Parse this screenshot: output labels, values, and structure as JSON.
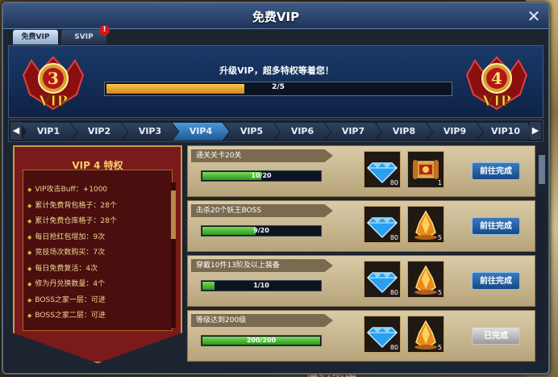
{
  "window": {
    "title": "免费VIP",
    "close": "✕"
  },
  "tabs": [
    {
      "label": "免费VIP",
      "active": true
    },
    {
      "label": "SVIP",
      "active": false,
      "badge": "!"
    }
  ],
  "header": {
    "current_vip": "3",
    "next_vip": "4",
    "vip_label": "VIP",
    "upgrade_text": "升级VIP，超多特权等着您！",
    "progress_text": "2/5",
    "progress_fraction": 0.4
  },
  "levels": {
    "items": [
      "VIP1",
      "VIP2",
      "VIP3",
      "VIP4",
      "VIP5",
      "VIP6",
      "VIP7",
      "VIP8",
      "VIP9",
      "VIP10"
    ],
    "active_index": 3,
    "prev_arrow": "◀",
    "next_arrow": "▶"
  },
  "privileges": {
    "title": "VIP 4 特权",
    "items": [
      "VIP攻击Buff：+1000",
      "累计免费背包格子：28个",
      "累计免费仓库格子：28个",
      "每日抢红包增加：9次",
      "竞技场次数购买：7次",
      "每日免费复活：4次",
      "修为丹兑换数量：4个",
      "BOSS之家一层：可进",
      "BOSS之家二层：可进"
    ]
  },
  "tasks": [
    {
      "label": "通关关卡20关",
      "progress": "10/20",
      "fraction": 0.5,
      "reward1_count": "80",
      "reward2_count": "1",
      "reward2_icon": "scroll-icon",
      "button": "前往完成",
      "done": false
    },
    {
      "label": "击杀20个妖王BOSS",
      "progress": "9/20",
      "fraction": 0.45,
      "reward1_count": "80",
      "reward2_count": "5",
      "reward2_icon": "crystal-icon",
      "button": "前往完成",
      "done": false
    },
    {
      "label": "穿戴10件13阶及以上装备",
      "progress": "1/10",
      "fraction": 0.1,
      "reward1_count": "80",
      "reward2_count": "5",
      "reward2_icon": "crystal-icon",
      "button": "前往完成",
      "done": false
    },
    {
      "label": "等级达到200级",
      "progress": "200/200",
      "fraction": 1.0,
      "reward1_count": "80",
      "reward2_count": "5",
      "reward2_icon": "crystal-icon",
      "button": "已完成",
      "done": true
    }
  ],
  "background": {
    "bottom_text": "福利地图"
  },
  "colors": {
    "accent": "#1e5a96",
    "gold": "#f5d06a",
    "banner_red": "#7a1a1a",
    "progress_orange": "#d5881a",
    "progress_green": "#2a9a1a"
  }
}
